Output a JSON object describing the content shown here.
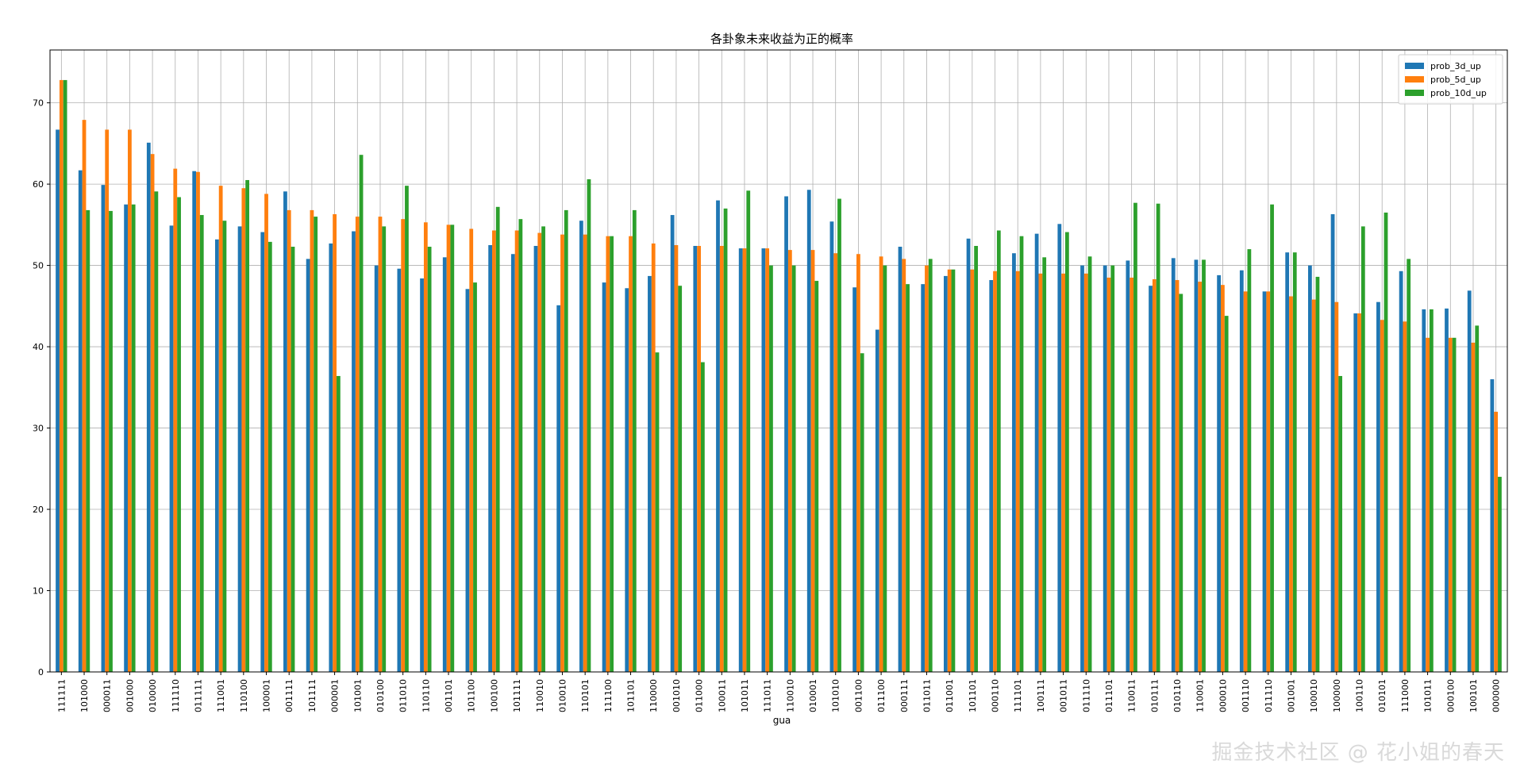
{
  "watermark": "掘金技术社区 @ 花小姐的春天",
  "colors": {
    "prob_3d_up": "#1f77b4",
    "prob_5d_up": "#ff7f0e",
    "prob_10d_up": "#2ca02c",
    "grid": "#b0b0b0"
  },
  "chart_data": {
    "type": "bar",
    "title": "各卦象未来收益为正的概率",
    "xlabel": "gua",
    "ylabel": "",
    "ylim": [
      0,
      76.5
    ],
    "yticks": [
      0,
      10,
      20,
      30,
      40,
      50,
      60,
      70
    ],
    "grid": true,
    "legend_position": "top-right",
    "categories": [
      "111111",
      "101000",
      "000011",
      "001000",
      "010000",
      "111110",
      "011111",
      "111001",
      "110100",
      "100001",
      "001111",
      "101111",
      "000001",
      "101001",
      "010100",
      "011010",
      "110110",
      "001101",
      "101100",
      "100100",
      "101111",
      "110010",
      "010010",
      "110101",
      "111100",
      "101101",
      "110000",
      "001010",
      "011000",
      "100011",
      "101011",
      "111011",
      "110010",
      "010001",
      "101010",
      "001100",
      "011100",
      "000111",
      "011011",
      "011001",
      "101101",
      "000110",
      "111101",
      "100111",
      "001011",
      "011110",
      "011101",
      "110011",
      "010111",
      "010110",
      "110001",
      "000010",
      "001110",
      "011110",
      "001001",
      "100010",
      "100000",
      "100110",
      "010101",
      "111000",
      "101011",
      "000100",
      "100101",
      "000000"
    ],
    "series": [
      {
        "name": "prob_3d_up",
        "values": [
          66.7,
          61.7,
          59.9,
          57.5,
          65.1,
          54.9,
          61.6,
          53.2,
          54.8,
          54.1,
          59.1,
          50.8,
          52.7,
          54.2,
          50.0,
          49.6,
          48.4,
          51.0,
          47.1,
          52.5,
          51.4,
          52.4,
          45.1,
          55.5,
          47.9,
          47.2,
          48.7,
          56.2,
          52.4,
          58.0,
          52.1,
          52.1,
          58.5,
          59.3,
          55.4,
          47.3,
          42.1,
          52.3,
          47.7,
          48.7,
          53.3,
          48.2,
          51.5,
          53.9,
          55.1,
          50.0,
          50.0,
          50.6,
          47.5,
          50.9,
          50.7,
          48.8,
          49.4,
          46.8,
          51.6,
          50.0,
          56.3,
          44.1,
          45.5,
          49.3,
          44.6,
          44.7,
          46.9,
          36.0
        ]
      },
      {
        "name": "prob_5d_up",
        "values": [
          72.8,
          67.9,
          66.7,
          66.7,
          63.7,
          61.9,
          61.5,
          59.8,
          59.5,
          58.8,
          56.8,
          56.8,
          56.3,
          56.0,
          56.0,
          55.7,
          55.3,
          55.0,
          54.5,
          54.3,
          54.3,
          54.0,
          53.8,
          53.8,
          53.6,
          53.6,
          52.7,
          52.5,
          52.4,
          52.4,
          52.1,
          52.1,
          51.9,
          51.9,
          51.5,
          51.4,
          51.1,
          50.8,
          50.0,
          49.5,
          49.5,
          49.3,
          49.3,
          49.0,
          49.0,
          49.0,
          48.5,
          48.5,
          48.3,
          48.2,
          48.0,
          47.6,
          46.8,
          46.8,
          46.2,
          45.8,
          45.5,
          44.1,
          43.3,
          43.1,
          41.1,
          41.1,
          40.5,
          32.0
        ]
      },
      {
        "name": "prob_10d_up",
        "values": [
          72.8,
          56.8,
          56.7,
          57.5,
          59.1,
          58.4,
          56.2,
          55.5,
          60.5,
          52.9,
          52.3,
          56.0,
          36.4,
          63.6,
          54.8,
          59.8,
          52.3,
          55.0,
          47.9,
          57.2,
          55.7,
          54.8,
          56.8,
          60.6,
          53.6,
          56.8,
          39.3,
          47.5,
          38.1,
          57.0,
          59.2,
          50.0,
          50.0,
          48.1,
          58.2,
          39.2,
          50.0,
          47.7,
          50.8,
          49.5,
          52.4,
          54.3,
          53.6,
          51.0,
          54.1,
          51.1,
          50.0,
          57.7,
          57.6,
          46.5,
          50.7,
          43.8,
          52.0,
          57.5,
          51.6,
          48.6,
          36.4,
          54.8,
          56.5,
          50.8,
          44.6,
          41.1,
          42.6,
          24.0
        ]
      }
    ]
  }
}
